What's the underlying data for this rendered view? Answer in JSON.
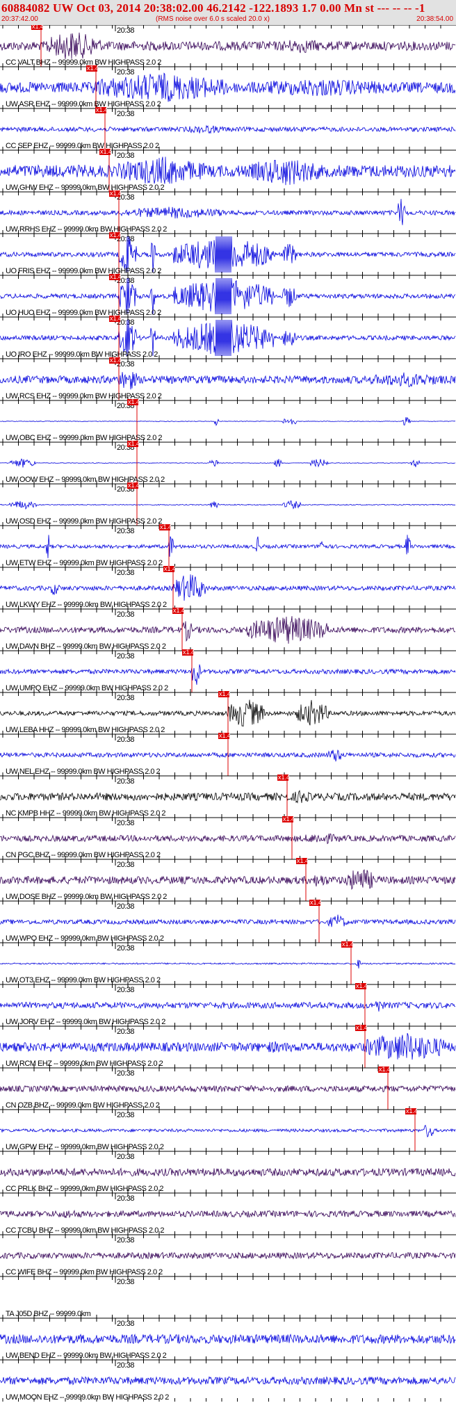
{
  "header": {
    "title": "60884082 UW Oct 03, 2014 20:38:02.00   46.2142 -122.1893  1.7 0.00 Mn st --- -- --  -1",
    "start_time": "20:37:42.00",
    "note": "(RMS noise over 6.0 s scaled 20.0 x)",
    "end_time": "20:38:54.00"
  },
  "minute_label": "20:38",
  "pick_label": "x1.4",
  "colors": {
    "title_red": "#d80000",
    "header_bg": "#e2e2e2",
    "blue_trace": "#0000dd",
    "dark_trace": "#330055",
    "black_trace": "#000000",
    "pick_red": "#dd0000"
  },
  "traces": [
    {
      "label": "CC VALT BHZ -- 99999.0km BW  HIGHPASS  2.0  2",
      "color": "dark",
      "pick": 0.09,
      "bursts": [
        [
          0.1,
          0.22,
          1.0
        ],
        [
          0.6,
          0.72,
          0.5
        ]
      ],
      "amp": 0.3
    },
    {
      "label": "UW ASR EHZ -- 99999.0km BW  HIGHPASS  2.0  2",
      "color": "blue",
      "pick": 0.21,
      "bursts": [
        [
          0.2,
          0.5,
          1.0
        ],
        [
          0.5,
          0.9,
          0.6
        ]
      ],
      "amp": 0.35
    },
    {
      "label": "CC SEP EHZ -- 99999.0km BW  HIGHPASS  2.0  2",
      "color": "blue",
      "pick": 0.23,
      "bursts": [
        [
          0.4,
          0.5,
          0.3
        ]
      ],
      "amp": 0.15
    },
    {
      "label": "UW GHW EHZ -- 99999.0km BW  HIGHPASS  2.0  2",
      "color": "blue",
      "pick": 0.24,
      "bursts": [
        [
          0.26,
          0.45,
          1.0
        ],
        [
          0.55,
          0.7,
          1.0
        ]
      ],
      "amp": 0.4
    },
    {
      "label": "UW RRHS EHZ -- 99999.0km BW  HIGHPASS  2.0  2",
      "color": "blue",
      "pick": 0.26,
      "bursts": [
        [
          0.26,
          0.5,
          0.4
        ],
        [
          0.87,
          0.89,
          1.0
        ]
      ],
      "amp": 0.15
    },
    {
      "label": "UO FRIS EHZ -- 99999.0km BW  HIGHPASS  2.0  2",
      "color": "blue",
      "pick": 0.26,
      "bursts": [
        [
          0.26,
          0.3,
          1.2
        ],
        [
          0.33,
          0.34,
          1.2
        ],
        [
          0.38,
          0.6,
          1.2
        ],
        [
          0.62,
          0.65,
          0.8
        ]
      ],
      "amp": 0.15,
      "saturated": true
    },
    {
      "label": "UO HUO EHZ -- 99999.0km BW  HIGHPASS  2.0  2",
      "color": "blue",
      "pick": 0.26,
      "bursts": [
        [
          0.26,
          0.3,
          1.2
        ],
        [
          0.33,
          0.34,
          1.2
        ],
        [
          0.38,
          0.6,
          1.2
        ],
        [
          0.62,
          0.65,
          0.8
        ]
      ],
      "amp": 0.15,
      "saturated": true
    },
    {
      "label": "UO IRO EHZ -- 99999.0km BW  HIGHPASS  2.0  2",
      "color": "blue",
      "pick": 0.26,
      "bursts": [
        [
          0.26,
          0.3,
          1.2
        ],
        [
          0.33,
          0.34,
          1.2
        ],
        [
          0.38,
          0.6,
          1.2
        ],
        [
          0.62,
          0.65,
          0.8
        ]
      ],
      "amp": 0.15,
      "saturated": true
    },
    {
      "label": "UW RCS EHZ -- 99999.0km BW  HIGHPASS  2.0  2",
      "color": "blue",
      "pick": 0.26,
      "bursts": [
        [
          0.26,
          0.3,
          0.8
        ],
        [
          0.8,
          0.98,
          0.5
        ]
      ],
      "amp": 0.25
    },
    {
      "label": "UW OBC EHZ -- 99999.0km BW  HIGHPASS  2.0  2",
      "color": "blue",
      "pick": 0.3,
      "bursts": [
        [
          0.47,
          0.48,
          0.3
        ],
        [
          0.62,
          0.65,
          0.3
        ],
        [
          0.88,
          0.9,
          0.3
        ]
      ],
      "amp": 0.02
    },
    {
      "label": "UW OOW EHZ -- 99999.0km BW  HIGHPASS  2.0  2",
      "color": "blue",
      "pick": 0.3,
      "bursts": [
        [
          0.02,
          0.08,
          0.3
        ],
        [
          0.46,
          0.48,
          0.3
        ],
        [
          0.6,
          0.62,
          0.3
        ],
        [
          0.68,
          0.72,
          0.3
        ],
        [
          0.9,
          0.92,
          0.3
        ]
      ],
      "amp": 0.02
    },
    {
      "label": "UW OSD EHZ -- 99999.0km BW  HIGHPASS  2.0  2",
      "color": "blue",
      "pick": 0.3,
      "bursts": [
        [
          0.02,
          0.08,
          0.3
        ],
        [
          0.46,
          0.48,
          0.3
        ],
        [
          0.62,
          0.66,
          0.3
        ]
      ],
      "amp": 0.03
    },
    {
      "label": "UW ETW EHZ -- 99999.0km BW  HIGHPASS  2.0  2",
      "color": "blue",
      "pick": 0.37,
      "bursts": [
        [
          0.1,
          0.11,
          1.0
        ],
        [
          0.37,
          0.38,
          1.0
        ],
        [
          0.56,
          0.57,
          1.0
        ],
        [
          0.7,
          0.71,
          1.0
        ],
        [
          0.89,
          0.9,
          1.0
        ]
      ],
      "amp": 0.12
    },
    {
      "label": "UW LKWY EHZ -- 99999.0km BW  HIGHPASS  2.0  2",
      "color": "blue",
      "pick": 0.38,
      "bursts": [
        [
          0.11,
          0.13,
          0.5
        ],
        [
          0.38,
          0.45,
          1.0
        ]
      ],
      "amp": 0.15
    },
    {
      "label": "UW DAVN BHZ -- 99999.0km BW  HIGHPASS  2.0  2",
      "color": "dark",
      "pick": 0.4,
      "bursts": [
        [
          0.4,
          0.42,
          0.8
        ],
        [
          0.54,
          0.72,
          1.0
        ]
      ],
      "amp": 0.2
    },
    {
      "label": "UW UMPQ EHZ -- 99999.0km BW  HIGHPASS  2.0  2",
      "color": "blue",
      "pick": 0.42,
      "bursts": [
        [
          0.42,
          0.44,
          1.0
        ]
      ],
      "amp": 0.15
    },
    {
      "label": "UW LEBA HHZ -- 99999.0km BW  HIGHPASS  2.0  2",
      "color": "black",
      "pick": 0.5,
      "bursts": [
        [
          0.5,
          0.58,
          1.0
        ],
        [
          0.65,
          0.72,
          0.9
        ]
      ],
      "amp": 0.15
    },
    {
      "label": "UW NEL EHZ -- 99999.0km BW  HIGHPASS  2.0  2",
      "color": "blue",
      "pick": 0.5,
      "bursts": [
        [
          0.72,
          0.75,
          0.5
        ]
      ],
      "amp": 0.15
    },
    {
      "label": "NC KMPB HHZ -- 99999.0km BW  HIGHPASS  2.0  2",
      "color": "black",
      "pick": 0.63,
      "bursts": [
        [
          0.64,
          0.68,
          0.5
        ]
      ],
      "amp": 0.25
    },
    {
      "label": "CN PGC BHZ -- 99999.0km BW  HIGHPASS  2.0  2",
      "color": "dark",
      "pick": 0.64,
      "bursts": [
        [
          0.66,
          0.75,
          0.4
        ]
      ],
      "amp": 0.2
    },
    {
      "label": "UW DOSE BHZ -- 99999.0km BW  HIGHPASS  2.0  2",
      "color": "dark",
      "pick": 0.67,
      "bursts": [
        [
          0.68,
          0.72,
          0.5
        ],
        [
          0.76,
          0.82,
          0.9
        ]
      ],
      "amp": 0.25
    },
    {
      "label": "UW WPO EHZ -- 99999.0km BW  HIGHPASS  2.0  2",
      "color": "blue",
      "pick": 0.7,
      "bursts": [
        [
          0.72,
          0.76,
          0.5
        ]
      ],
      "amp": 0.15
    },
    {
      "label": "UW OT3 EHZ -- 99999.0km BW  HIGHPASS  2.0  2",
      "color": "blue",
      "pick": 0.77,
      "bursts": [
        [
          0.78,
          0.79,
          0.4
        ]
      ],
      "amp": 0.05
    },
    {
      "label": "UW JORV EHZ -- 99999.0km BW  HIGHPASS  2.0  2",
      "color": "blue",
      "pick": 0.8,
      "bursts": [
        [
          0.82,
          0.84,
          0.5
        ]
      ],
      "amp": 0.2
    },
    {
      "label": "UW RCM EHZ -- 99999.0km BW  HIGHPASS  2.0  2",
      "color": "blue",
      "pick": 0.8,
      "bursts": [
        [
          0.8,
          0.98,
          1.0
        ],
        [
          0.55,
          0.65,
          0.4
        ]
      ],
      "amp": 0.3
    },
    {
      "label": "CN OZB BHZ -- 99999.0km BW  HIGHPASS  2.0  2",
      "color": "dark",
      "pick": 0.85,
      "bursts": [],
      "amp": 0.2
    },
    {
      "label": "UW GPW EHZ -- 99999.0km BW  HIGHPASS  2.0  2",
      "color": "blue",
      "pick": 0.91,
      "bursts": [
        [
          0.93,
          0.95,
          0.6
        ]
      ],
      "amp": 0.1
    },
    {
      "label": "CC PRLK BHZ -- 99999.0km BW  HIGHPASS  2.0  2",
      "color": "dark",
      "pick": null,
      "bursts": [],
      "amp": 0.25
    },
    {
      "label": "CC TCBU BHZ -- 99999.0km BW  HIGHPASS  2.0  2",
      "color": "dark",
      "pick": null,
      "bursts": [
        [
          0.1,
          0.2,
          0.3
        ]
      ],
      "amp": 0.2
    },
    {
      "label": "CC WIFE BHZ -- 99999.0km BW  HIGHPASS  2.0  2",
      "color": "dark",
      "pick": null,
      "bursts": [],
      "amp": 0.2
    },
    {
      "label": "TA J05D BHZ -- 99999.0km",
      "color": "dark",
      "pick": null,
      "bursts": [],
      "amp": 0.0,
      "dead": true
    },
    {
      "label": "UW BEND EHZ -- 99999.0km BW  HIGHPASS  2.0  2",
      "color": "blue",
      "pick": null,
      "bursts": [],
      "amp": 0.3
    },
    {
      "label": "UW MOON EHZ -- 99999.0km BW  HIGHPASS  2.0  2",
      "color": "blue",
      "pick": null,
      "bursts": [],
      "amp": 0.25
    }
  ]
}
